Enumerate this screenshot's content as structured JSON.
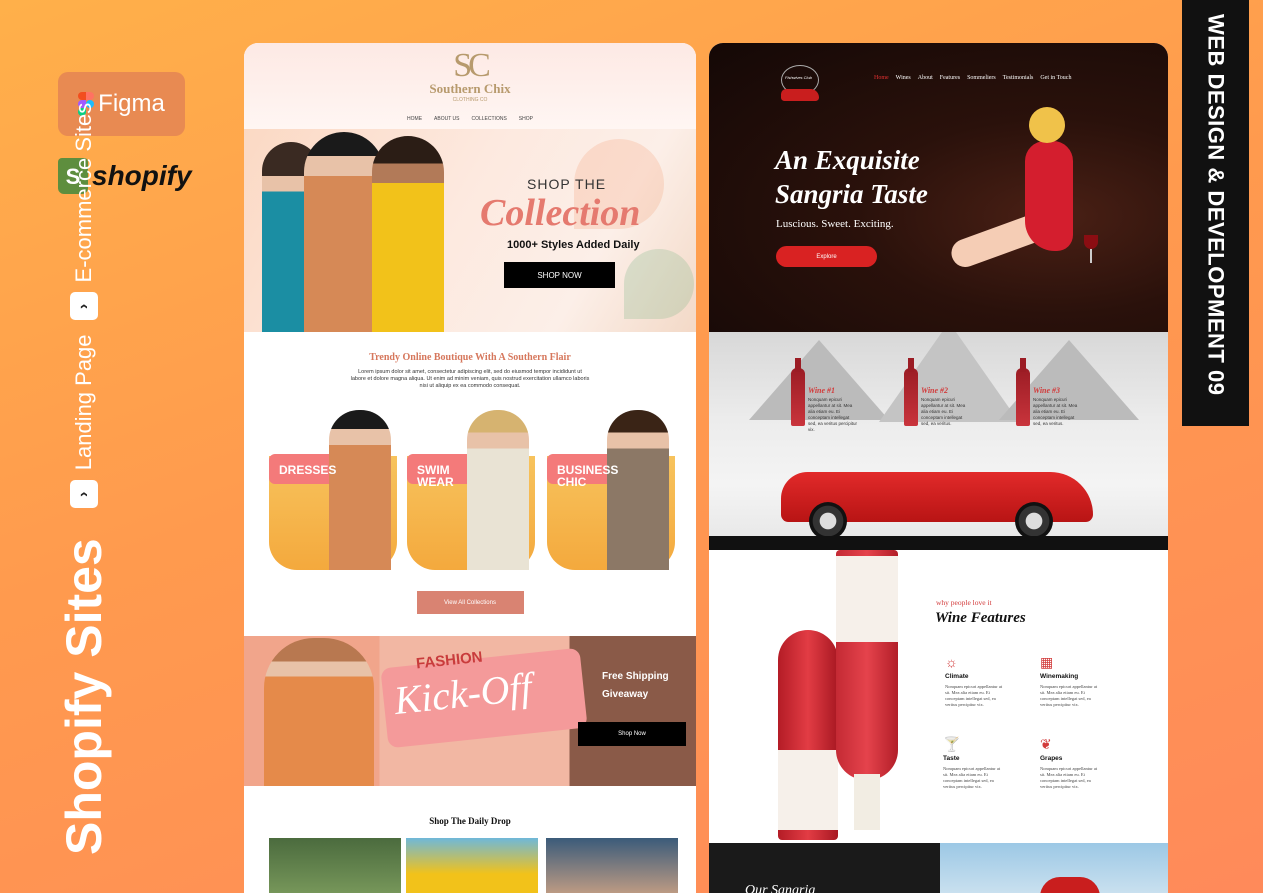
{
  "branding": {
    "figma_label": "Figma",
    "shopify_label": "shopify",
    "title": "Shopify Sites",
    "tag1": "Landing Page",
    "tag2": "E-commerce Sites",
    "arrow": "›",
    "side_band": "WEB DESIGN & DEVELOPMENT   09"
  },
  "southern_chix": {
    "logo_mark": "SC",
    "logo_name": "Southern Chix",
    "logo_sub": "CLOTHING CO",
    "nav": [
      "HOME",
      "ABOUT US",
      "COLLECTIONS",
      "SHOP"
    ],
    "hero": {
      "shop_the": "SHOP THE",
      "collection": "Collection",
      "styles": "1000+ Styles Added Daily",
      "button": "SHOP NOW"
    },
    "intro_title": "Trendy Online Boutique With A Southern Flair",
    "intro_text": "Lorem ipsum dolor sit amet, consectetur adipiscing elit, sed do eiusmod tempor incididunt ut labore et dolore magna aliqua. Ut enim ad minim veniam, quis nostrud exercitation ullamco laboris nisi ut aliquip ex ea commodo consequat.",
    "categories": [
      {
        "label": "DRESSES"
      },
      {
        "label": "SWIM WEAR"
      },
      {
        "label": "BUSINESS CHIC"
      }
    ],
    "view_all": "View All Collections",
    "promo": {
      "fashion": "FASHION",
      "kickoff": "Kick-Off",
      "free_line1": "Free Shipping",
      "free_line2": "Giveaway",
      "button": "Shop Now"
    },
    "daily_drop": "Shop The Daily Drop"
  },
  "sangria": {
    "logo_text": "Fishwives Club",
    "nav": [
      "Home",
      "Wines",
      "About",
      "Features",
      "Sommeliers",
      "Testimonials",
      "Get in Touch"
    ],
    "hero": {
      "title_line1": "An Exquisite",
      "title_line2": "Sangria Taste",
      "tagline": "Luscious. Sweet. Exciting.",
      "button": "Explore"
    },
    "wines": [
      {
        "name": "Wine #1",
        "desc": "Nonquam epicuri appellantur at sit. Mea alia etiam eu. Ei conceptam intellegat sed, ea veritus percipitur vix."
      },
      {
        "name": "Wine #2",
        "desc": "Nonquam epicuri appellantur at sit. Mea alia etiam eu. Ei conceptam intellegat sed, ea veritus."
      },
      {
        "name": "Wine #3",
        "desc": "Nonquam epicuri appellantur at sit. Mea alia etiam eu. Ei conceptam intellegat sed, ea veritus."
      }
    ],
    "why": "why people love it",
    "features_title": "Wine Features",
    "features": [
      {
        "icon": "☼",
        "title": "Climate",
        "desc": "Nonquam epicuri appellantur at sit. Mea alia etiam eu. Ei conceptam intellegat sed, ea veritus percipitur vix."
      },
      {
        "icon": "▦",
        "title": "Winemaking",
        "desc": "Nonquam epicuri appellantur at sit. Mea alia etiam eu. Ei conceptam intellegat sed, ea veritus percipitur vix."
      },
      {
        "icon": "🍸",
        "title": "Taste",
        "desc": "Nonquam epicuri appellantur at sit. Mea alia etiam eu. Ei conceptam intellegat sed, ea veritus percipitur vix."
      },
      {
        "icon": "❦",
        "title": "Grapes",
        "desc": "Nonquam epicuri appellantur at sit. Mea alia etiam eu. Ei conceptam intellegat sed, ea veritus percipitur vix."
      }
    ],
    "bottom_heading": "Our Sangria"
  },
  "colors": {
    "background_orange": "#ff9a4e",
    "coral_accent": "#e57a6f",
    "sangria_red": "#d92222"
  }
}
